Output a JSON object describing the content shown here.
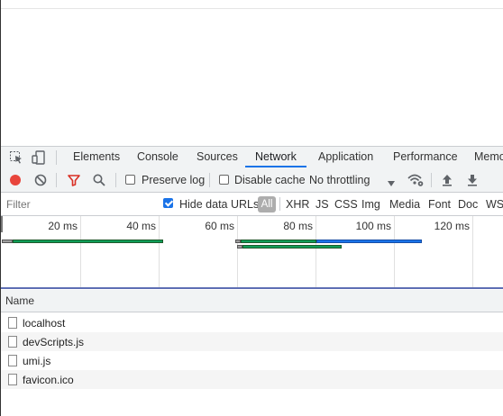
{
  "devtools": {
    "tabs": [
      "Elements",
      "Console",
      "Sources",
      "Network",
      "Application",
      "Performance",
      "Memo"
    ],
    "active_tab": "Network",
    "toolbar": {
      "preserve_log_label": "Preserve log",
      "disable_cache_label": "Disable cache",
      "throttling_value": "No throttling",
      "preserve_log_checked": false,
      "disable_cache_checked": false,
      "record_color": "#e8453c",
      "filter_icon_color": "#d93025"
    },
    "filter": {
      "placeholder": "Filter",
      "hide_data_urls_label": "Hide data URLs",
      "hide_data_urls_checked": true,
      "types": [
        "All",
        "XHR",
        "JS",
        "CSS",
        "Img",
        "Media",
        "Font",
        "Doc",
        "WS"
      ],
      "active_type": "All"
    },
    "overview": {
      "ticks": [
        "20 ms",
        "40 ms",
        "60 ms",
        "80 ms",
        "100 ms",
        "120 ms"
      ],
      "bar_colors": {
        "waiting": "#0f9d58",
        "download": "#1a73e8",
        "queue": "#9e9e9e"
      }
    },
    "requests": {
      "column_name": "Name",
      "items": [
        "localhost",
        "devScripts.js",
        "umi.js",
        "favicon.ico"
      ]
    }
  }
}
